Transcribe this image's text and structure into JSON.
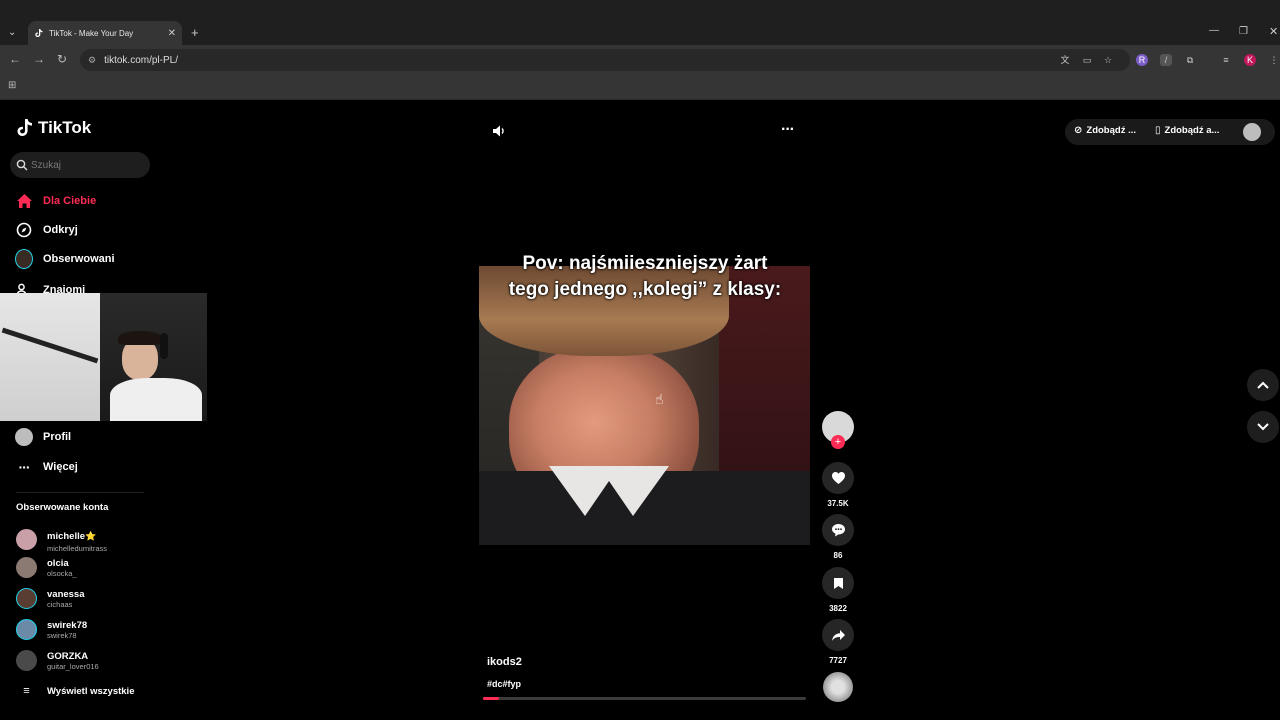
{
  "browser": {
    "tab_title": "TikTok - Make Your Day",
    "url": "tiktok.com/pl-PL/"
  },
  "tiktok": {
    "logo_text": "TikTok",
    "search_placeholder": "Szukaj",
    "nav": {
      "for_you": "Dla Ciebie",
      "explore": "Odkryj",
      "following": "Obserwowani",
      "friends": "Znajomi",
      "profile": "Profil",
      "more": "Więcej"
    },
    "following_title": "Obserwowane konta",
    "accounts": [
      {
        "name": "michelle",
        "handle": "michelledumitrass",
        "color": "#c9a0a8"
      },
      {
        "name": "olcia",
        "handle": "olsocka_",
        "color": "#8a7a72"
      },
      {
        "name": "vanessa",
        "handle": "cichaas",
        "color": "#5a3d32"
      },
      {
        "name": "swirek78",
        "handle": "swirek78",
        "color": "#6b8aa8"
      },
      {
        "name": "GORZKA",
        "handle": "guitar_lover016",
        "color": "#4a4a4a"
      }
    ],
    "see_all": "Wyświetl wszystkie",
    "header_buttons": [
      "Zdobądź ...",
      "Zdobądź a..."
    ],
    "accent": "#fe2c55"
  },
  "video": {
    "caption_line1": "Pov: najśmiieszniejszy żart",
    "caption_line2": "tego jednego ,,kolegi” z klasy:",
    "author": "ikods2",
    "hashtags": "#dc#fyp",
    "likes": "37.5K",
    "comments": "86",
    "saves": "3822",
    "shares": "7727",
    "progress": 0.05
  }
}
